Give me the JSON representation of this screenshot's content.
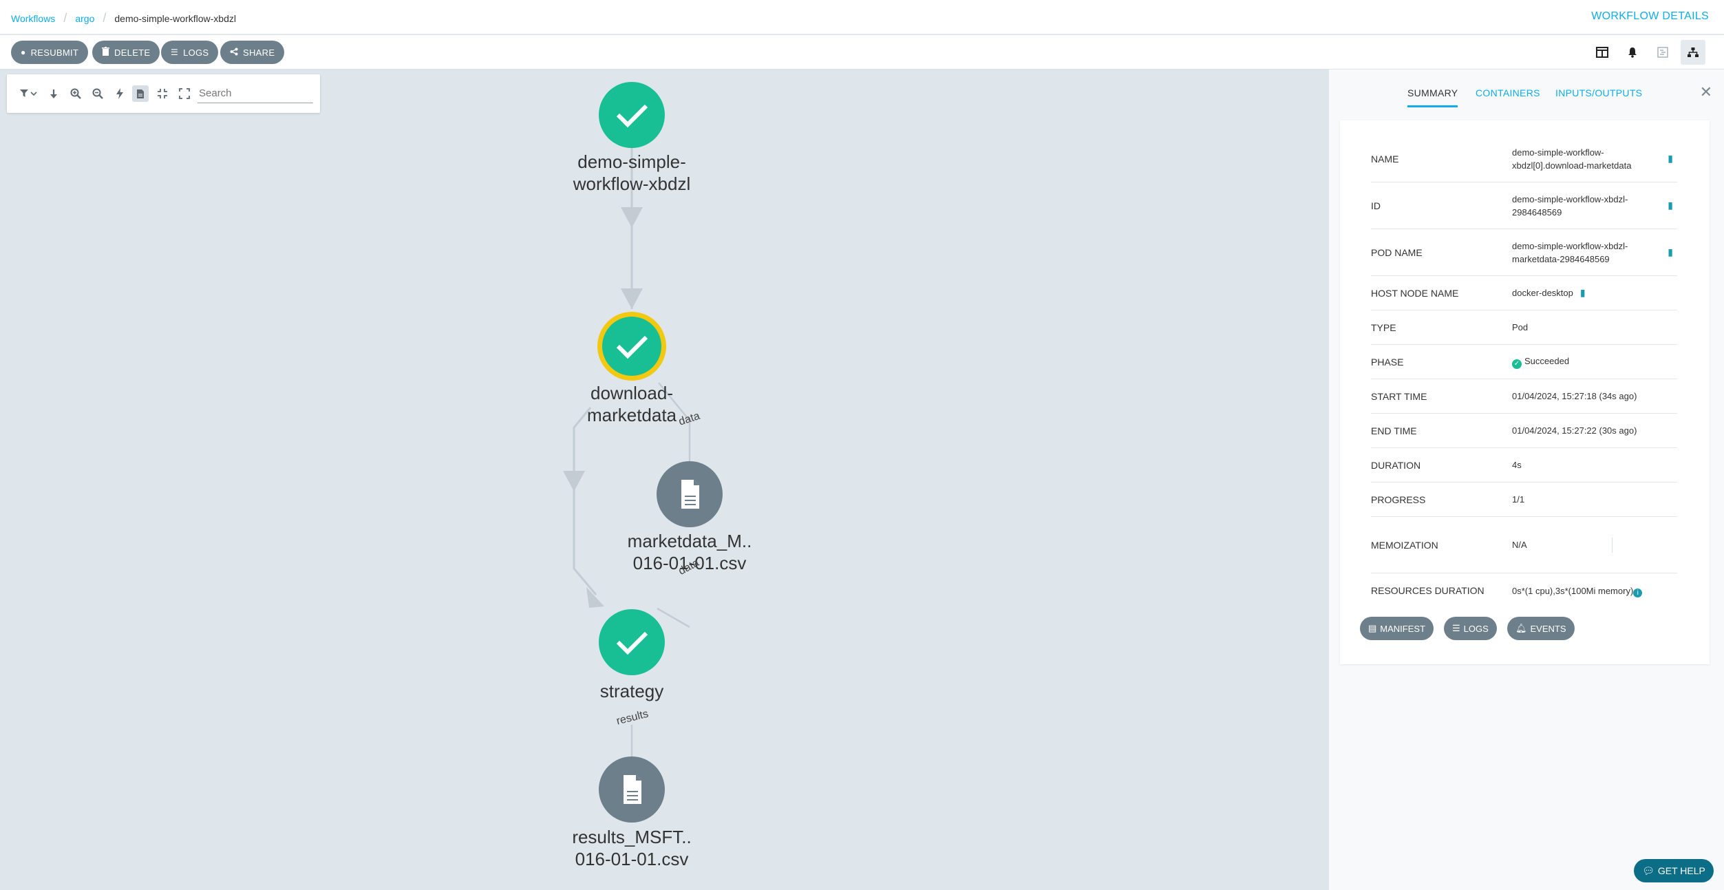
{
  "breadcrumb": {
    "item1": "Workflows",
    "item2": "argo",
    "current": "demo-simple-workflow-xbdzl"
  },
  "header": {
    "title": "WORKFLOW DETAILS"
  },
  "toolbar": {
    "resubmit": "RESUBMIT",
    "delete": "DELETE",
    "logs": "LOGS",
    "share": "SHARE"
  },
  "graph": {
    "search_placeholder": "Search",
    "nodes": [
      {
        "line1": "demo-simple-",
        "line2": "workflow-xbdzl",
        "kind": "succeeded"
      },
      {
        "line1": "download-",
        "line2": "marketdata",
        "kind": "succeeded-selected"
      },
      {
        "line1": "marketdata_M..",
        "line2": "016-01-01.csv",
        "kind": "artifact"
      },
      {
        "line1": "strategy",
        "line2": "",
        "kind": "succeeded"
      },
      {
        "line1": "results_MSFT..",
        "line2": "016-01-01.csv",
        "kind": "artifact"
      }
    ],
    "edge_labels": {
      "data1": "data",
      "data2": "data",
      "results": "results"
    }
  },
  "details": {
    "tabs": {
      "summary": "SUMMARY",
      "containers": "CONTAINERS",
      "io": "INPUTS/OUTPUTS"
    },
    "rows": {
      "name": {
        "label": "NAME",
        "v1": "demo-simple-workflow-",
        "v2": "xbdzl[0].download-marketdata"
      },
      "id": {
        "label": "ID",
        "v1": "demo-simple-workflow-xbdzl-",
        "v2": "2984648569"
      },
      "pod": {
        "label": "POD NAME",
        "v1": "demo-simple-workflow-xbdzl-",
        "v2": "marketdata-2984648569"
      },
      "host": {
        "label": "HOST NODE NAME",
        "value": "docker-desktop"
      },
      "type": {
        "label": "TYPE",
        "value": "Pod"
      },
      "phase": {
        "label": "PHASE",
        "value": "Succeeded"
      },
      "start": {
        "label": "START TIME",
        "value": "01/04/2024, 15:27:18 (34s ago)"
      },
      "end": {
        "label": "END TIME",
        "value": "01/04/2024, 15:27:22 (30s ago)"
      },
      "duration": {
        "label": "DURATION",
        "value": "4s"
      },
      "progress": {
        "label": "PROGRESS",
        "value": "1/1"
      },
      "memo": {
        "label": "MEMOIZATION",
        "value": "N/A"
      },
      "resources": {
        "label": "RESOURCES DURATION",
        "value": "0s*(1 cpu),3s*(100Mi memory)"
      }
    },
    "buttons": {
      "manifest": "MANIFEST",
      "logs": "LOGS",
      "events": "EVENTS"
    }
  },
  "help": {
    "label": "GET HELP"
  },
  "colors": {
    "accent": "#0dadea",
    "success": "#18be94",
    "selected_ring": "#f2c811",
    "artifact": "#6d7f8b",
    "button": "#6d7f8b"
  }
}
